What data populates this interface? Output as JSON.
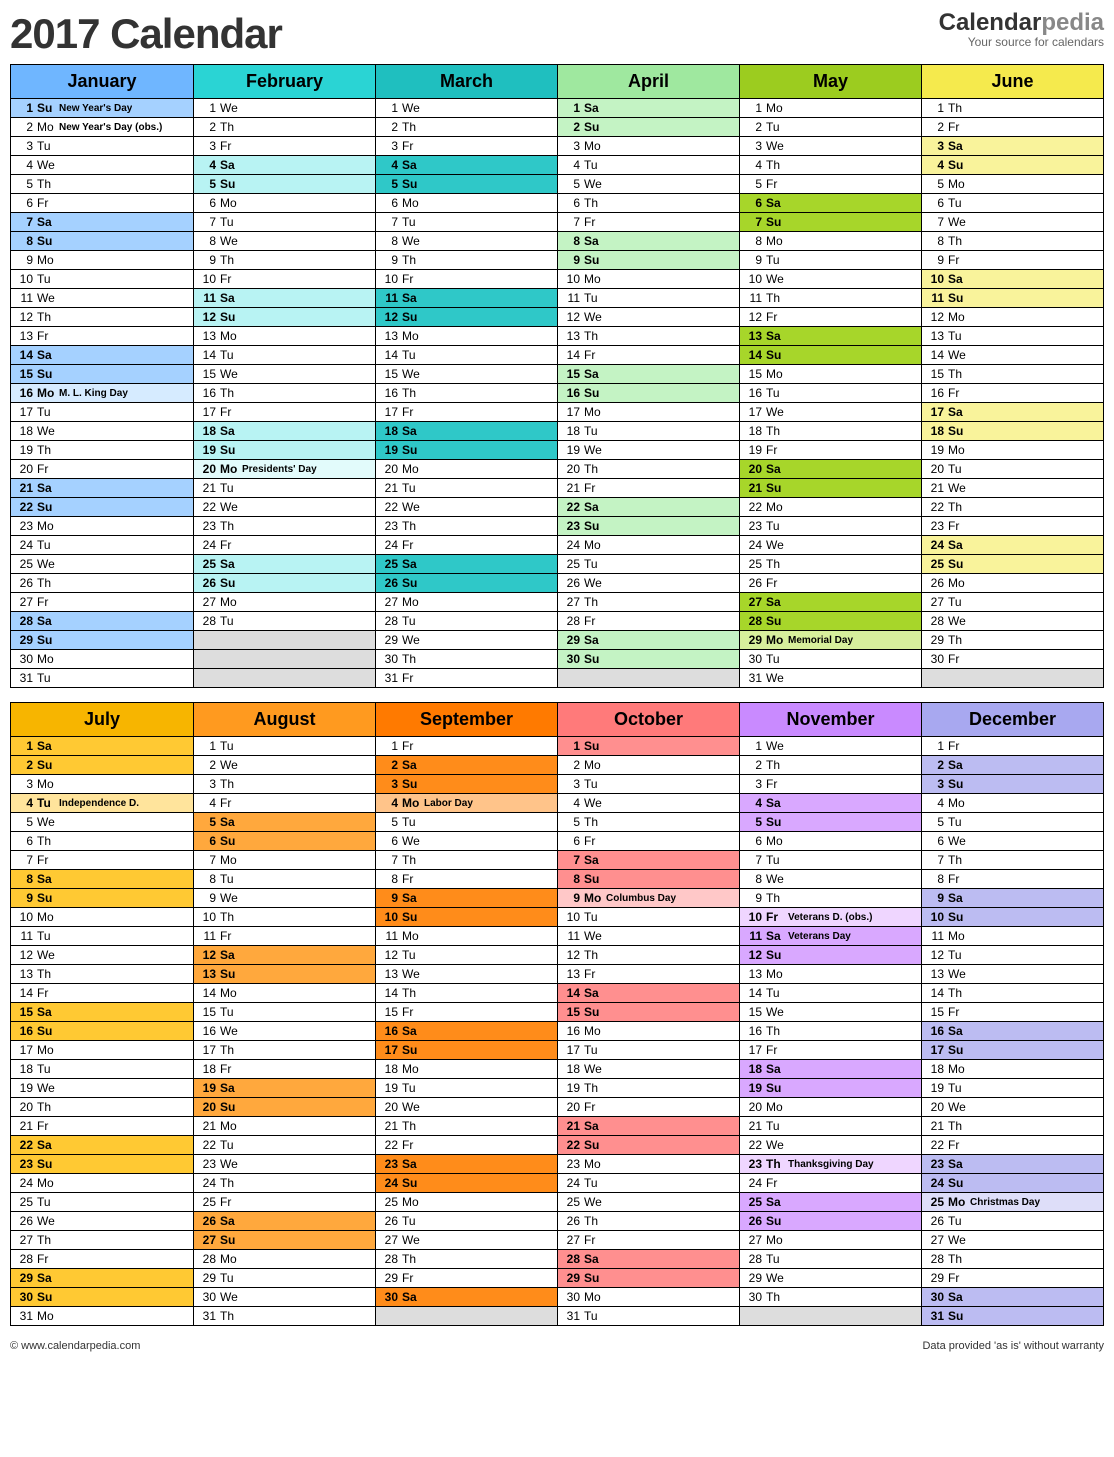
{
  "title": "2017 Calendar",
  "brand_p1": "Calendar",
  "brand_p2": "pedia",
  "brand_tag": "Your source for calendars",
  "footer_left": "© www.calendarpedia.com",
  "footer_right": "Data provided 'as is' without warranty",
  "weekdays": [
    "Su",
    "Mo",
    "Tu",
    "We",
    "Th",
    "Fr",
    "Sa"
  ],
  "colors": {
    "January": {
      "head": "#6fb6ff",
      "wk": "#a5d1ff",
      "light": "#d6ebff"
    },
    "February": {
      "head": "#2ad4d4",
      "wk": "#b8f3f3",
      "light": "#e2fbfb"
    },
    "March": {
      "head": "#1fbfbf",
      "wk": "#2fc8c8",
      "light": "#bdf0ee"
    },
    "April": {
      "head": "#9fe89f",
      "wk": "#c4f3c4",
      "light": "#e4fae4"
    },
    "May": {
      "head": "#9ccc1f",
      "wk": "#a7d62a",
      "light": "#d7ef9c"
    },
    "June": {
      "head": "#f5ea4d",
      "wk": "#f9f39b",
      "light": "#fdfad1"
    },
    "July": {
      "head": "#f7b500",
      "wk": "#ffc933",
      "light": "#ffe49c"
    },
    "August": {
      "head": "#ff9a1f",
      "wk": "#ffa83d",
      "light": "#ffd4a0"
    },
    "September": {
      "head": "#ff7a00",
      "wk": "#ff8c1a",
      "light": "#ffc48a"
    },
    "October": {
      "head": "#ff7a7a",
      "wk": "#ff8f8f",
      "light": "#ffc8c8"
    },
    "November": {
      "head": "#c98aff",
      "wk": "#d9a8ff",
      "light": "#efd6ff"
    },
    "December": {
      "head": "#a8a8f0",
      "wk": "#bcbcf2",
      "light": "#dedef9"
    }
  },
  "months": [
    {
      "name": "January",
      "days": 31,
      "startDow": 0,
      "events": {
        "1": "New Year's Day",
        "2": "New Year's Day (obs.)",
        "16": "M. L. King Day"
      },
      "hl": [
        16
      ]
    },
    {
      "name": "February",
      "days": 28,
      "startDow": 3,
      "events": {
        "20": "Presidents' Day"
      },
      "hl": [
        20
      ]
    },
    {
      "name": "March",
      "days": 31,
      "startDow": 3,
      "events": {},
      "hl": []
    },
    {
      "name": "April",
      "days": 30,
      "startDow": 6,
      "events": {},
      "hl": []
    },
    {
      "name": "May",
      "days": 31,
      "startDow": 1,
      "events": {
        "29": "Memorial Day"
      },
      "hl": [
        29
      ]
    },
    {
      "name": "June",
      "days": 30,
      "startDow": 4,
      "events": {},
      "hl": []
    },
    {
      "name": "July",
      "days": 31,
      "startDow": 6,
      "events": {
        "4": "Independence D."
      },
      "hl": [
        4
      ]
    },
    {
      "name": "August",
      "days": 31,
      "startDow": 2,
      "events": {},
      "hl": []
    },
    {
      "name": "September",
      "days": 30,
      "startDow": 5,
      "events": {
        "4": "Labor Day"
      },
      "hl": [
        4
      ]
    },
    {
      "name": "October",
      "days": 31,
      "startDow": 0,
      "events": {
        "9": "Columbus Day"
      },
      "hl": [
        9
      ]
    },
    {
      "name": "November",
      "days": 30,
      "startDow": 3,
      "events": {
        "10": "Veterans D. (obs.)",
        "11": "Veterans Day",
        "23": "Thanksgiving Day"
      },
      "hl": [
        10,
        23
      ]
    },
    {
      "name": "December",
      "days": 31,
      "startDow": 5,
      "events": {
        "25": "Christmas Day"
      },
      "hl": [
        25
      ]
    }
  ]
}
